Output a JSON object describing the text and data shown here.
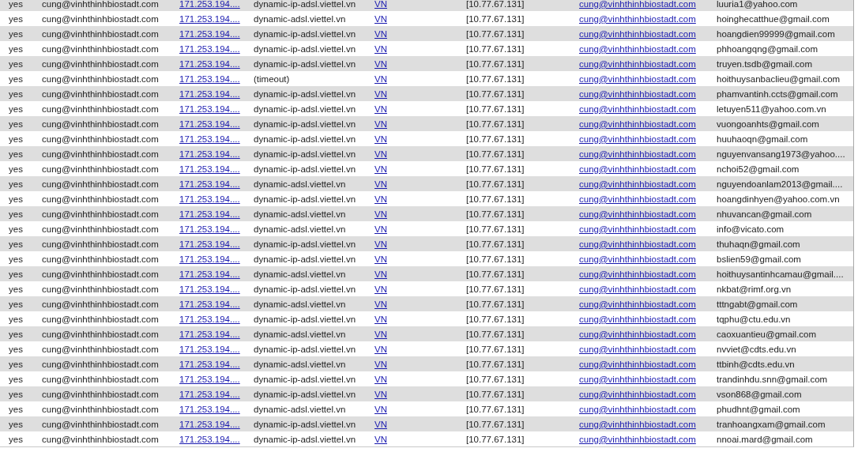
{
  "rows": [
    [
      {
        "text": "yes",
        "kind": "text"
      },
      {
        "text": "cung@vinhthinhbiostadt.com",
        "kind": "text"
      },
      {
        "text": "171.253.194....",
        "kind": "link"
      },
      {
        "text": "dynamic-ip-adsl.viettel.vn",
        "kind": "text"
      },
      {
        "text": "VN",
        "kind": "link"
      },
      {
        "text": "[10.77.67.131]",
        "kind": "text"
      },
      {
        "text": "cung@vinhthinhbiostadt.com",
        "kind": "link"
      },
      {
        "text": "luuria1@yahoo.com",
        "kind": "text"
      }
    ],
    [
      {
        "text": "yes",
        "kind": "text"
      },
      {
        "text": "cung@vinhthinhbiostadt.com",
        "kind": "text"
      },
      {
        "text": "171.253.194....",
        "kind": "link"
      },
      {
        "text": "dynamic-adsl.viettel.vn",
        "kind": "text"
      },
      {
        "text": "VN",
        "kind": "link"
      },
      {
        "text": "[10.77.67.131]",
        "kind": "text"
      },
      {
        "text": "cung@vinhthinhbiostadt.com",
        "kind": "link"
      },
      {
        "text": "hoinghecatthue@gmail.com",
        "kind": "text"
      }
    ],
    [
      {
        "text": "yes",
        "kind": "text"
      },
      {
        "text": "cung@vinhthinhbiostadt.com",
        "kind": "text"
      },
      {
        "text": "171.253.194....",
        "kind": "link"
      },
      {
        "text": "dynamic-ip-adsl.viettel.vn",
        "kind": "text"
      },
      {
        "text": "VN",
        "kind": "link"
      },
      {
        "text": "[10.77.67.131]",
        "kind": "text"
      },
      {
        "text": "cung@vinhthinhbiostadt.com",
        "kind": "link"
      },
      {
        "text": "hoangdien99999@gmail.com",
        "kind": "text"
      }
    ],
    [
      {
        "text": "yes",
        "kind": "text"
      },
      {
        "text": "cung@vinhthinhbiostadt.com",
        "kind": "text"
      },
      {
        "text": "171.253.194....",
        "kind": "link"
      },
      {
        "text": "dynamic-ip-adsl.viettel.vn",
        "kind": "text"
      },
      {
        "text": "VN",
        "kind": "link"
      },
      {
        "text": "[10.77.67.131]",
        "kind": "text"
      },
      {
        "text": "cung@vinhthinhbiostadt.com",
        "kind": "link"
      },
      {
        "text": "phhoangqng@gmail.com",
        "kind": "text"
      }
    ],
    [
      {
        "text": "yes",
        "kind": "text"
      },
      {
        "text": "cung@vinhthinhbiostadt.com",
        "kind": "text"
      },
      {
        "text": "171.253.194....",
        "kind": "link"
      },
      {
        "text": "dynamic-ip-adsl.viettel.vn",
        "kind": "text"
      },
      {
        "text": "VN",
        "kind": "link"
      },
      {
        "text": "[10.77.67.131]",
        "kind": "text"
      },
      {
        "text": "cung@vinhthinhbiostadt.com",
        "kind": "link"
      },
      {
        "text": "truyen.tsdb@gmail.com",
        "kind": "text"
      }
    ],
    [
      {
        "text": "yes",
        "kind": "text"
      },
      {
        "text": "cung@vinhthinhbiostadt.com",
        "kind": "text"
      },
      {
        "text": "171.253.194....",
        "kind": "link"
      },
      {
        "text": "(timeout)",
        "kind": "text"
      },
      {
        "text": "VN",
        "kind": "link"
      },
      {
        "text": "[10.77.67.131]",
        "kind": "text"
      },
      {
        "text": "cung@vinhthinhbiostadt.com",
        "kind": "link"
      },
      {
        "text": "hoithuysanbaclieu@gmail.com",
        "kind": "text"
      }
    ],
    [
      {
        "text": "yes",
        "kind": "text"
      },
      {
        "text": "cung@vinhthinhbiostadt.com",
        "kind": "text"
      },
      {
        "text": "171.253.194....",
        "kind": "link"
      },
      {
        "text": "dynamic-ip-adsl.viettel.vn",
        "kind": "text"
      },
      {
        "text": "VN",
        "kind": "link"
      },
      {
        "text": "[10.77.67.131]",
        "kind": "text"
      },
      {
        "text": "cung@vinhthinhbiostadt.com",
        "kind": "link"
      },
      {
        "text": "phamvantinh.ccts@gmail.com",
        "kind": "text"
      }
    ],
    [
      {
        "text": "yes",
        "kind": "text"
      },
      {
        "text": "cung@vinhthinhbiostadt.com",
        "kind": "text"
      },
      {
        "text": "171.253.194....",
        "kind": "link"
      },
      {
        "text": "dynamic-ip-adsl.viettel.vn",
        "kind": "text"
      },
      {
        "text": "VN",
        "kind": "link"
      },
      {
        "text": "[10.77.67.131]",
        "kind": "text"
      },
      {
        "text": "cung@vinhthinhbiostadt.com",
        "kind": "link"
      },
      {
        "text": "letuyen511@yahoo.com.vn",
        "kind": "text"
      }
    ],
    [
      {
        "text": "yes",
        "kind": "text"
      },
      {
        "text": "cung@vinhthinhbiostadt.com",
        "kind": "text"
      },
      {
        "text": "171.253.194....",
        "kind": "link"
      },
      {
        "text": "dynamic-ip-adsl.viettel.vn",
        "kind": "text"
      },
      {
        "text": "VN",
        "kind": "link"
      },
      {
        "text": "[10.77.67.131]",
        "kind": "text"
      },
      {
        "text": "cung@vinhthinhbiostadt.com",
        "kind": "link"
      },
      {
        "text": "vuongoanhts@gmail.com",
        "kind": "text"
      }
    ],
    [
      {
        "text": "yes",
        "kind": "text"
      },
      {
        "text": "cung@vinhthinhbiostadt.com",
        "kind": "text"
      },
      {
        "text": "171.253.194....",
        "kind": "link"
      },
      {
        "text": "dynamic-ip-adsl.viettel.vn",
        "kind": "text"
      },
      {
        "text": "VN",
        "kind": "link"
      },
      {
        "text": "[10.77.67.131]",
        "kind": "text"
      },
      {
        "text": "cung@vinhthinhbiostadt.com",
        "kind": "link"
      },
      {
        "text": "huuhaoqn@gmail.com",
        "kind": "text"
      }
    ],
    [
      {
        "text": "yes",
        "kind": "text"
      },
      {
        "text": "cung@vinhthinhbiostadt.com",
        "kind": "text"
      },
      {
        "text": "171.253.194....",
        "kind": "link"
      },
      {
        "text": "dynamic-ip-adsl.viettel.vn",
        "kind": "text"
      },
      {
        "text": "VN",
        "kind": "link"
      },
      {
        "text": "[10.77.67.131]",
        "kind": "text"
      },
      {
        "text": "cung@vinhthinhbiostadt.com",
        "kind": "link"
      },
      {
        "text": "nguyenvansang1973@yahoo....",
        "kind": "text"
      }
    ],
    [
      {
        "text": "yes",
        "kind": "text"
      },
      {
        "text": "cung@vinhthinhbiostadt.com",
        "kind": "text"
      },
      {
        "text": "171.253.194....",
        "kind": "link"
      },
      {
        "text": "dynamic-ip-adsl.viettel.vn",
        "kind": "text"
      },
      {
        "text": "VN",
        "kind": "link"
      },
      {
        "text": "[10.77.67.131]",
        "kind": "text"
      },
      {
        "text": "cung@vinhthinhbiostadt.com",
        "kind": "link"
      },
      {
        "text": "nchoi52@gmail.com",
        "kind": "text"
      }
    ],
    [
      {
        "text": "yes",
        "kind": "text"
      },
      {
        "text": "cung@vinhthinhbiostadt.com",
        "kind": "text"
      },
      {
        "text": "171.253.194....",
        "kind": "link"
      },
      {
        "text": "dynamic-adsl.viettel.vn",
        "kind": "text"
      },
      {
        "text": "VN",
        "kind": "link"
      },
      {
        "text": "[10.77.67.131]",
        "kind": "text"
      },
      {
        "text": "cung@vinhthinhbiostadt.com",
        "kind": "link"
      },
      {
        "text": "nguyendoanlam2013@gmail....",
        "kind": "text"
      }
    ],
    [
      {
        "text": "yes",
        "kind": "text"
      },
      {
        "text": "cung@vinhthinhbiostadt.com",
        "kind": "text"
      },
      {
        "text": "171.253.194....",
        "kind": "link"
      },
      {
        "text": "dynamic-ip-adsl.viettel.vn",
        "kind": "text"
      },
      {
        "text": "VN",
        "kind": "link"
      },
      {
        "text": "[10.77.67.131]",
        "kind": "text"
      },
      {
        "text": "cung@vinhthinhbiostadt.com",
        "kind": "link"
      },
      {
        "text": "hoangdinhyen@yahoo.com.vn",
        "kind": "text"
      }
    ],
    [
      {
        "text": "yes",
        "kind": "text"
      },
      {
        "text": "cung@vinhthinhbiostadt.com",
        "kind": "text"
      },
      {
        "text": "171.253.194....",
        "kind": "link"
      },
      {
        "text": "dynamic-adsl.viettel.vn",
        "kind": "text"
      },
      {
        "text": "VN",
        "kind": "link"
      },
      {
        "text": "[10.77.67.131]",
        "kind": "text"
      },
      {
        "text": "cung@vinhthinhbiostadt.com",
        "kind": "link"
      },
      {
        "text": "nhuvancan@gmail.com",
        "kind": "text"
      }
    ],
    [
      {
        "text": "yes",
        "kind": "text"
      },
      {
        "text": "cung@vinhthinhbiostadt.com",
        "kind": "text"
      },
      {
        "text": "171.253.194....",
        "kind": "link"
      },
      {
        "text": "dynamic-adsl.viettel.vn",
        "kind": "text"
      },
      {
        "text": "VN",
        "kind": "link"
      },
      {
        "text": "[10.77.67.131]",
        "kind": "text"
      },
      {
        "text": "cung@vinhthinhbiostadt.com",
        "kind": "link"
      },
      {
        "text": "info@vicato.com",
        "kind": "text"
      }
    ],
    [
      {
        "text": "yes",
        "kind": "text"
      },
      {
        "text": "cung@vinhthinhbiostadt.com",
        "kind": "text"
      },
      {
        "text": "171.253.194....",
        "kind": "link"
      },
      {
        "text": "dynamic-ip-adsl.viettel.vn",
        "kind": "text"
      },
      {
        "text": "VN",
        "kind": "link"
      },
      {
        "text": "[10.77.67.131]",
        "kind": "text"
      },
      {
        "text": "cung@vinhthinhbiostadt.com",
        "kind": "link"
      },
      {
        "text": "thuhaqn@gmail.com",
        "kind": "text"
      }
    ],
    [
      {
        "text": "yes",
        "kind": "text"
      },
      {
        "text": "cung@vinhthinhbiostadt.com",
        "kind": "text"
      },
      {
        "text": "171.253.194....",
        "kind": "link"
      },
      {
        "text": "dynamic-ip-adsl.viettel.vn",
        "kind": "text"
      },
      {
        "text": "VN",
        "kind": "link"
      },
      {
        "text": "[10.77.67.131]",
        "kind": "text"
      },
      {
        "text": "cung@vinhthinhbiostadt.com",
        "kind": "link"
      },
      {
        "text": "bslien59@gmail.com",
        "kind": "text"
      }
    ],
    [
      {
        "text": "yes",
        "kind": "text"
      },
      {
        "text": "cung@vinhthinhbiostadt.com",
        "kind": "text"
      },
      {
        "text": "171.253.194....",
        "kind": "link"
      },
      {
        "text": "dynamic-adsl.viettel.vn",
        "kind": "text"
      },
      {
        "text": "VN",
        "kind": "link"
      },
      {
        "text": "[10.77.67.131]",
        "kind": "text"
      },
      {
        "text": "cung@vinhthinhbiostadt.com",
        "kind": "link"
      },
      {
        "text": "hoithuysantinhcamau@gmail....",
        "kind": "text"
      }
    ],
    [
      {
        "text": "yes",
        "kind": "text"
      },
      {
        "text": "cung@vinhthinhbiostadt.com",
        "kind": "text"
      },
      {
        "text": "171.253.194....",
        "kind": "link"
      },
      {
        "text": "dynamic-ip-adsl.viettel.vn",
        "kind": "text"
      },
      {
        "text": "VN",
        "kind": "link"
      },
      {
        "text": "[10.77.67.131]",
        "kind": "text"
      },
      {
        "text": "cung@vinhthinhbiostadt.com",
        "kind": "link"
      },
      {
        "text": "nkbat@rimf.org.vn",
        "kind": "text"
      }
    ],
    [
      {
        "text": "yes",
        "kind": "text"
      },
      {
        "text": "cung@vinhthinhbiostadt.com",
        "kind": "text"
      },
      {
        "text": "171.253.194....",
        "kind": "link"
      },
      {
        "text": "dynamic-adsl.viettel.vn",
        "kind": "text"
      },
      {
        "text": "VN",
        "kind": "link"
      },
      {
        "text": "[10.77.67.131]",
        "kind": "text"
      },
      {
        "text": "cung@vinhthinhbiostadt.com",
        "kind": "link"
      },
      {
        "text": "tttngabt@gmail.com",
        "kind": "text"
      }
    ],
    [
      {
        "text": "yes",
        "kind": "text"
      },
      {
        "text": "cung@vinhthinhbiostadt.com",
        "kind": "text"
      },
      {
        "text": "171.253.194....",
        "kind": "link"
      },
      {
        "text": "dynamic-ip-adsl.viettel.vn",
        "kind": "text"
      },
      {
        "text": "VN",
        "kind": "link"
      },
      {
        "text": "[10.77.67.131]",
        "kind": "text"
      },
      {
        "text": "cung@vinhthinhbiostadt.com",
        "kind": "link"
      },
      {
        "text": "tqphu@ctu.edu.vn",
        "kind": "text"
      }
    ],
    [
      {
        "text": "yes",
        "kind": "text"
      },
      {
        "text": "cung@vinhthinhbiostadt.com",
        "kind": "text"
      },
      {
        "text": "171.253.194....",
        "kind": "link"
      },
      {
        "text": "dynamic-adsl.viettel.vn",
        "kind": "text"
      },
      {
        "text": "VN",
        "kind": "link"
      },
      {
        "text": "[10.77.67.131]",
        "kind": "text"
      },
      {
        "text": "cung@vinhthinhbiostadt.com",
        "kind": "link"
      },
      {
        "text": "caoxuantieu@gmail.com",
        "kind": "text"
      }
    ],
    [
      {
        "text": "yes",
        "kind": "text"
      },
      {
        "text": "cung@vinhthinhbiostadt.com",
        "kind": "text"
      },
      {
        "text": "171.253.194....",
        "kind": "link"
      },
      {
        "text": "dynamic-ip-adsl.viettel.vn",
        "kind": "text"
      },
      {
        "text": "VN",
        "kind": "link"
      },
      {
        "text": "[10.77.67.131]",
        "kind": "text"
      },
      {
        "text": "cung@vinhthinhbiostadt.com",
        "kind": "link"
      },
      {
        "text": "nvviet@cdts.edu.vn",
        "kind": "text"
      }
    ],
    [
      {
        "text": "yes",
        "kind": "text"
      },
      {
        "text": "cung@vinhthinhbiostadt.com",
        "kind": "text"
      },
      {
        "text": "171.253.194....",
        "kind": "link"
      },
      {
        "text": "dynamic-adsl.viettel.vn",
        "kind": "text"
      },
      {
        "text": "VN",
        "kind": "link"
      },
      {
        "text": "[10.77.67.131]",
        "kind": "text"
      },
      {
        "text": "cung@vinhthinhbiostadt.com",
        "kind": "link"
      },
      {
        "text": "ttbinh@cdts.edu.vn",
        "kind": "text"
      }
    ],
    [
      {
        "text": "yes",
        "kind": "text"
      },
      {
        "text": "cung@vinhthinhbiostadt.com",
        "kind": "text"
      },
      {
        "text": "171.253.194....",
        "kind": "link"
      },
      {
        "text": "dynamic-ip-adsl.viettel.vn",
        "kind": "text"
      },
      {
        "text": "VN",
        "kind": "link"
      },
      {
        "text": "[10.77.67.131]",
        "kind": "text"
      },
      {
        "text": "cung@vinhthinhbiostadt.com",
        "kind": "link"
      },
      {
        "text": "trandinhdu.snn@gmail.com",
        "kind": "text"
      }
    ],
    [
      {
        "text": "yes",
        "kind": "text"
      },
      {
        "text": "cung@vinhthinhbiostadt.com",
        "kind": "text"
      },
      {
        "text": "171.253.194....",
        "kind": "link"
      },
      {
        "text": "dynamic-ip-adsl.viettel.vn",
        "kind": "text"
      },
      {
        "text": "VN",
        "kind": "link"
      },
      {
        "text": "[10.77.67.131]",
        "kind": "text"
      },
      {
        "text": "cung@vinhthinhbiostadt.com",
        "kind": "link"
      },
      {
        "text": "vson868@gmail.com",
        "kind": "text"
      }
    ],
    [
      {
        "text": "yes",
        "kind": "text"
      },
      {
        "text": "cung@vinhthinhbiostadt.com",
        "kind": "text"
      },
      {
        "text": "171.253.194....",
        "kind": "link"
      },
      {
        "text": "dynamic-adsl.viettel.vn",
        "kind": "text"
      },
      {
        "text": "VN",
        "kind": "link"
      },
      {
        "text": "[10.77.67.131]",
        "kind": "text"
      },
      {
        "text": "cung@vinhthinhbiostadt.com",
        "kind": "link"
      },
      {
        "text": "phudhnt@gmail.com",
        "kind": "text"
      }
    ],
    [
      {
        "text": "yes",
        "kind": "text"
      },
      {
        "text": "cung@vinhthinhbiostadt.com",
        "kind": "text"
      },
      {
        "text": "171.253.194....",
        "kind": "link"
      },
      {
        "text": "dynamic-ip-adsl.viettel.vn",
        "kind": "text"
      },
      {
        "text": "VN",
        "kind": "link"
      },
      {
        "text": "[10.77.67.131]",
        "kind": "text"
      },
      {
        "text": "cung@vinhthinhbiostadt.com",
        "kind": "link"
      },
      {
        "text": "tranhoangxam@gmail.com",
        "kind": "text"
      }
    ],
    [
      {
        "text": "yes",
        "kind": "text"
      },
      {
        "text": "cung@vinhthinhbiostadt.com",
        "kind": "text"
      },
      {
        "text": "171.253.194....",
        "kind": "link"
      },
      {
        "text": "dynamic-ip-adsl.viettel.vn",
        "kind": "text"
      },
      {
        "text": "VN",
        "kind": "link"
      },
      {
        "text": "[10.77.67.131]",
        "kind": "text"
      },
      {
        "text": "cung@vinhthinhbiostadt.com",
        "kind": "link"
      },
      {
        "text": "nnoai.mard@gmail.com",
        "kind": "text"
      }
    ]
  ]
}
